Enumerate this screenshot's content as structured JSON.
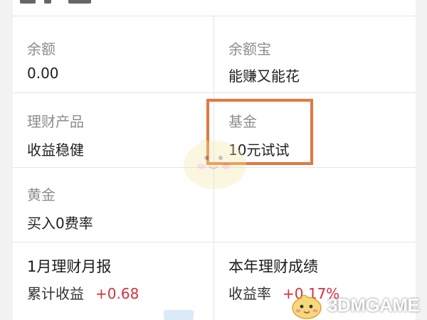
{
  "grid": {
    "balance": {
      "title": "余额",
      "value": "0.00"
    },
    "yuebao": {
      "title": "余额宝",
      "value": "能赚又能花"
    },
    "wealth_products": {
      "title": "理财产品",
      "value": "收益稳健"
    },
    "fund": {
      "title": "基金",
      "value": "10元试试"
    },
    "gold": {
      "title": "黄金",
      "value": "买入0费率"
    },
    "monthly_report": {
      "title": "1月理财月报",
      "label": "累计收益",
      "amount": "+0.68"
    },
    "yearly_performance": {
      "title": "本年理财成绩",
      "label": "收益率",
      "amount": "+0.17%"
    }
  },
  "highlight_color": "#e4773f",
  "positive_color": "#d8303c",
  "watermark": {
    "text": "3DMGAME"
  }
}
